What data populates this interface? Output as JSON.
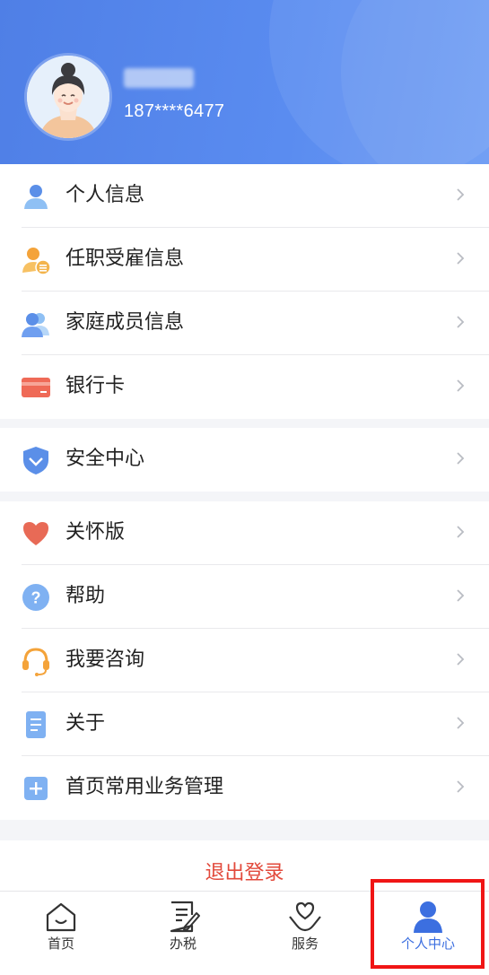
{
  "profile": {
    "phone": "187****6477"
  },
  "groups": [
    [
      {
        "label": "个人信息",
        "icon": "user-icon"
      },
      {
        "label": "任职受雇信息",
        "icon": "employment-icon"
      },
      {
        "label": "家庭成员信息",
        "icon": "family-icon"
      },
      {
        "label": "银行卡",
        "icon": "bank-card-icon"
      }
    ],
    [
      {
        "label": "安全中心",
        "icon": "shield-icon"
      }
    ],
    [
      {
        "label": "关怀版",
        "icon": "heart-icon"
      },
      {
        "label": "帮助",
        "icon": "help-icon"
      },
      {
        "label": "我要咨询",
        "icon": "headset-icon"
      },
      {
        "label": "关于",
        "icon": "document-icon"
      },
      {
        "label": "首页常用业务管理",
        "icon": "plus-square-icon"
      }
    ]
  ],
  "logout_label": "退出登录",
  "tabs": [
    {
      "label": "首页",
      "icon": "home-icon",
      "active": false
    },
    {
      "label": "办税",
      "icon": "tax-form-icon",
      "active": false
    },
    {
      "label": "服务",
      "icon": "heart-hand-icon",
      "active": false
    },
    {
      "label": "个人中心",
      "icon": "person-icon",
      "active": true
    }
  ],
  "colors": {
    "header": "#5585ec",
    "accent": "#3c6fe0",
    "logout": "#e2493b",
    "highlight": "#f01515"
  }
}
